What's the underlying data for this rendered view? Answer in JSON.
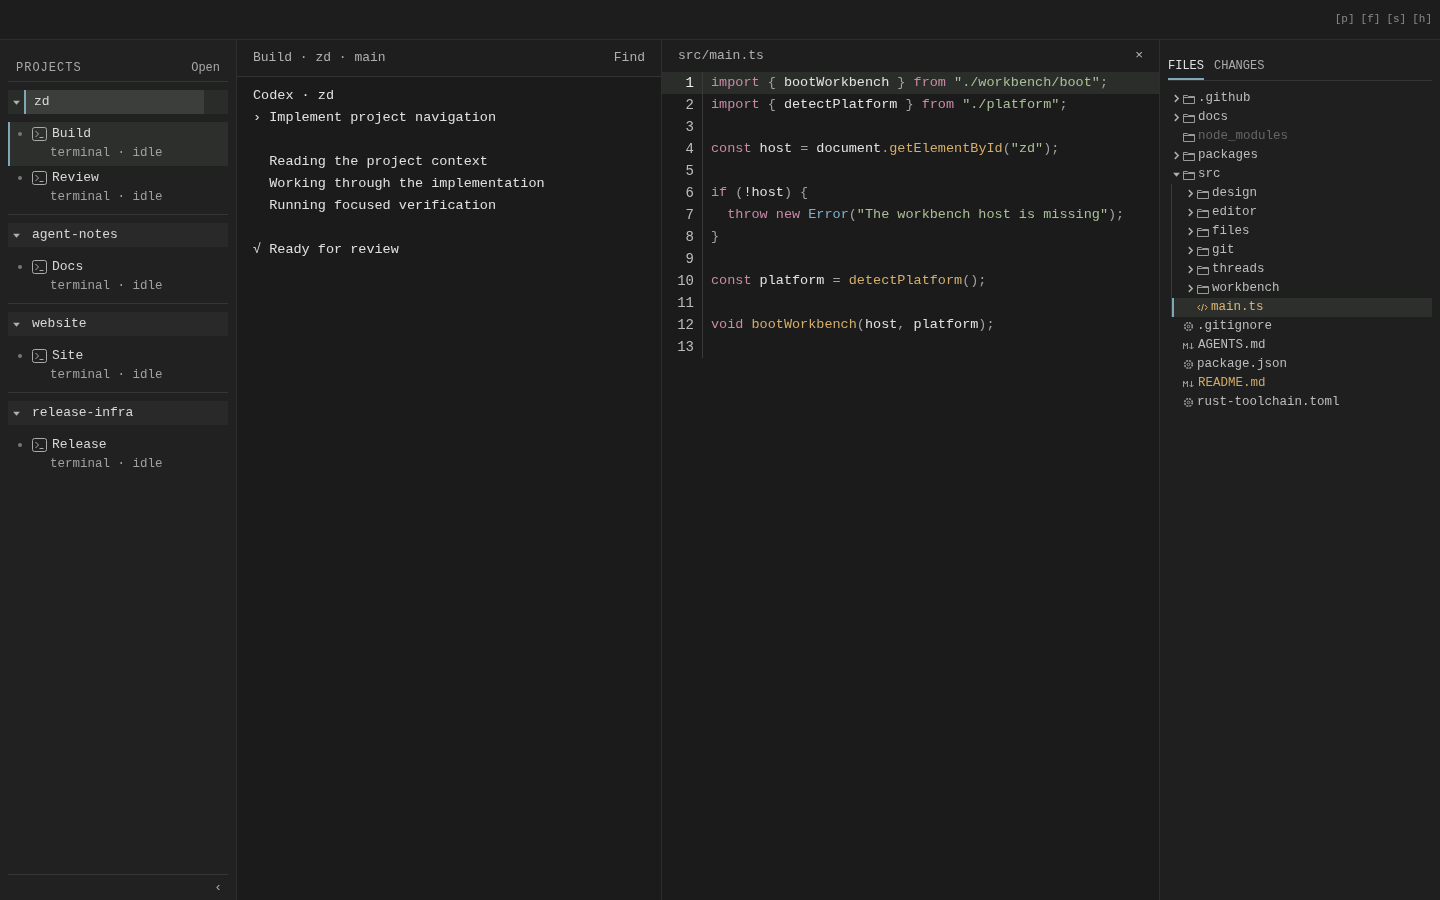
{
  "top_bar": {
    "shortcuts": [
      "[p]",
      "[f]",
      "[s]",
      "[h]"
    ]
  },
  "projects_panel": {
    "title": "PROJECTS",
    "open_label": "Open",
    "collapse": "‹",
    "projects": [
      {
        "name": "zd",
        "expanded": true,
        "selected": true,
        "sessions": [
          {
            "name": "Build",
            "detail": "terminal · idle",
            "selected": true
          },
          {
            "name": "Review",
            "detail": "terminal · idle",
            "selected": false
          }
        ]
      },
      {
        "name": "agent-notes",
        "expanded": true,
        "selected": false,
        "sessions": [
          {
            "name": "Docs",
            "detail": "terminal · idle",
            "selected": false
          }
        ]
      },
      {
        "name": "website",
        "expanded": true,
        "selected": false,
        "sessions": [
          {
            "name": "Site",
            "detail": "terminal · idle",
            "selected": false
          }
        ]
      },
      {
        "name": "release-infra",
        "expanded": true,
        "selected": false,
        "sessions": [
          {
            "name": "Release",
            "detail": "terminal · idle",
            "selected": false
          }
        ]
      }
    ]
  },
  "thread_panel": {
    "breadcrumb": "Build · zd · main",
    "find": "Find",
    "blocks": [
      [
        "Codex · zd",
        "› Implement project navigation"
      ],
      [
        "  Reading the project context",
        "  Working through the implementation",
        "  Running focused verification"
      ],
      [
        "√ Ready for review"
      ]
    ]
  },
  "editor": {
    "path": "src/main.ts",
    "close": "×",
    "lines": [
      {
        "number": "1",
        "current": true,
        "tokens": [
          {
            "kind": "kw",
            "text": "import"
          },
          {
            "kind": "punct",
            "text": " { "
          },
          {
            "kind": "plain",
            "text": "bootWorkbench"
          },
          {
            "kind": "punct",
            "text": " } "
          },
          {
            "kind": "kw",
            "text": "from"
          },
          {
            "kind": "str",
            "text": " \"./workbench/boot\""
          },
          {
            "kind": "punct",
            "text": ";"
          }
        ]
      },
      {
        "number": "2",
        "current": false,
        "tokens": [
          {
            "kind": "kw",
            "text": "import"
          },
          {
            "kind": "punct",
            "text": " { "
          },
          {
            "kind": "plain",
            "text": "detectPlatform"
          },
          {
            "kind": "punct",
            "text": " } "
          },
          {
            "kind": "kw",
            "text": "from"
          },
          {
            "kind": "str",
            "text": " \"./platform\""
          },
          {
            "kind": "punct",
            "text": ";"
          }
        ]
      },
      {
        "number": "3",
        "current": false
      },
      {
        "number": "4",
        "current": false,
        "tokens": [
          {
            "kind": "kw",
            "text": "const"
          },
          {
            "kind": "plain",
            "text": " host "
          },
          {
            "kind": "punct",
            "text": "="
          },
          {
            "kind": "plain",
            "text": " document"
          },
          {
            "kind": "punct",
            "text": "."
          },
          {
            "kind": "fn",
            "text": "getElementById"
          },
          {
            "kind": "punct",
            "text": "("
          },
          {
            "kind": "str",
            "text": "\"zd\""
          },
          {
            "kind": "punct",
            "text": ");"
          }
        ]
      },
      {
        "number": "5",
        "current": false
      },
      {
        "number": "6",
        "current": false,
        "tokens": [
          {
            "kind": "kw",
            "text": "if"
          },
          {
            "kind": "punct",
            "text": " ("
          },
          {
            "kind": "plain",
            "text": "!host"
          },
          {
            "kind": "punct",
            "text": ") {"
          }
        ]
      },
      {
        "number": "7",
        "current": false,
        "tokens": [
          {
            "kind": "kw",
            "text": "  throw new"
          },
          {
            "kind": "type",
            "text": " Error"
          },
          {
            "kind": "punct",
            "text": "("
          },
          {
            "kind": "str",
            "text": "\"The workbench host is missing\""
          },
          {
            "kind": "punct",
            "text": ");"
          }
        ]
      },
      {
        "number": "8",
        "current": false,
        "tokens": [
          {
            "kind": "punct",
            "text": "}"
          }
        ]
      },
      {
        "number": "9",
        "current": false
      },
      {
        "number": "10",
        "current": false,
        "tokens": [
          {
            "kind": "kw",
            "text": "const"
          },
          {
            "kind": "plain",
            "text": " platform "
          },
          {
            "kind": "punct",
            "text": "="
          },
          {
            "kind": "fn",
            "text": " detectPlatform"
          },
          {
            "kind": "punct",
            "text": "();"
          }
        ]
      },
      {
        "number": "11",
        "current": false
      },
      {
        "number": "12",
        "current": false,
        "tokens": [
          {
            "kind": "kw",
            "text": "void"
          },
          {
            "kind": "fn",
            "text": " bootWorkbench"
          },
          {
            "kind": "punct",
            "text": "("
          },
          {
            "kind": "plain",
            "text": "host"
          },
          {
            "kind": "punct",
            "text": ", "
          },
          {
            "kind": "plain",
            "text": "platform"
          },
          {
            "kind": "punct",
            "text": ");"
          }
        ]
      },
      {
        "number": "13",
        "current": false
      }
    ]
  },
  "files_panel": {
    "tabs": [
      {
        "label": "FILES",
        "selected": true
      },
      {
        "label": "CHANGES",
        "selected": false
      }
    ],
    "tree": [
      {
        "kind": "folder",
        "name": ".github",
        "expanded": false,
        "ignored": false,
        "modified": false,
        "selected": false
      },
      {
        "kind": "folder",
        "name": "docs",
        "expanded": false,
        "ignored": false,
        "modified": false,
        "selected": false
      },
      {
        "kind": "folder",
        "name": "node_modules",
        "ignored": true,
        "modified": false,
        "selected": false
      },
      {
        "kind": "folder",
        "name": "packages",
        "expanded": false,
        "ignored": false,
        "modified": false,
        "selected": false
      },
      {
        "kind": "folder",
        "name": "src",
        "expanded": true,
        "ignored": false,
        "modified": false,
        "selected": false,
        "children": [
          {
            "kind": "folder",
            "name": "design",
            "expanded": false,
            "ignored": false,
            "modified": false,
            "selected": false
          },
          {
            "kind": "folder",
            "name": "editor",
            "expanded": false,
            "ignored": false,
            "modified": false,
            "selected": false
          },
          {
            "kind": "folder",
            "name": "files",
            "expanded": false,
            "ignored": false,
            "modified": false,
            "selected": false
          },
          {
            "kind": "folder",
            "name": "git",
            "expanded": false,
            "ignored": false,
            "modified": false,
            "selected": false
          },
          {
            "kind": "folder",
            "name": "threads",
            "expanded": false,
            "ignored": false,
            "modified": false,
            "selected": false
          },
          {
            "kind": "folder",
            "name": "workbench",
            "expanded": false,
            "ignored": false,
            "modified": false,
            "selected": false
          },
          {
            "kind": "code",
            "name": "main.ts",
            "ignored": false,
            "modified": false,
            "selected": true
          }
        ]
      },
      {
        "kind": "config",
        "name": ".gitignore",
        "ignored": false,
        "modified": false,
        "selected": false
      },
      {
        "kind": "markdown",
        "name": "AGENTS.md",
        "ignored": false,
        "modified": false,
        "selected": false
      },
      {
        "kind": "config",
        "name": "package.json",
        "ignored": false,
        "modified": false,
        "selected": false
      },
      {
        "kind": "markdown",
        "name": "README.md",
        "ignored": false,
        "modified": true,
        "selected": false
      },
      {
        "kind": "config",
        "name": "rust-toolchain.toml",
        "ignored": false,
        "modified": false,
        "selected": false
      }
    ]
  }
}
